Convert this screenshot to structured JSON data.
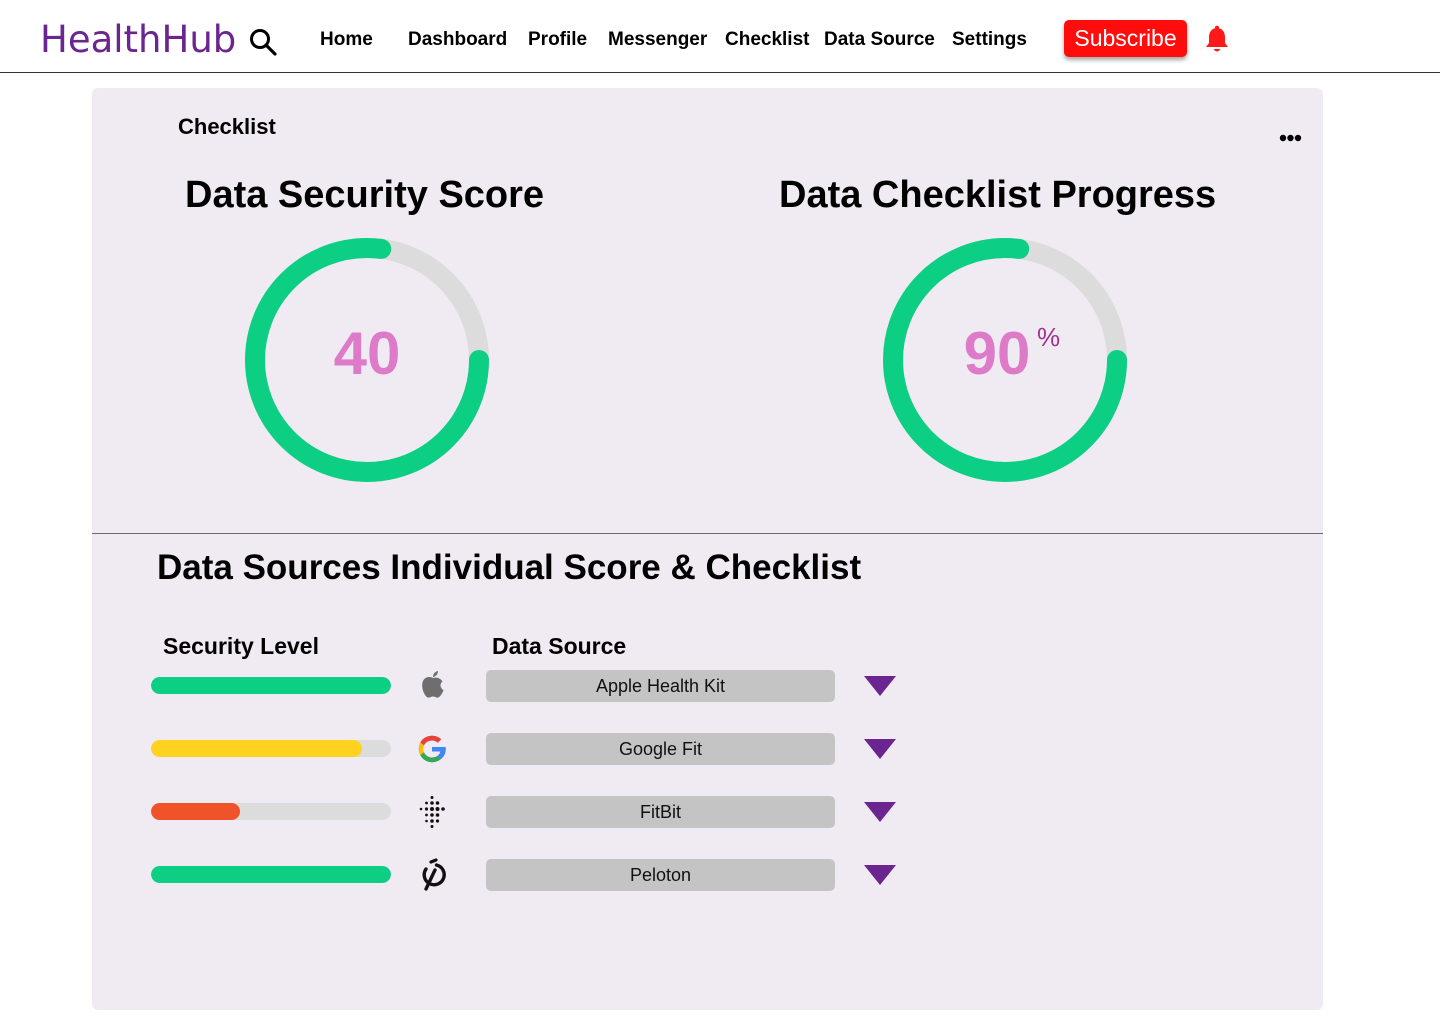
{
  "header": {
    "logo": "HealthHub",
    "nav": [
      "Home",
      "Dashboard",
      "Profile",
      "Messenger",
      "Checklist",
      "Data Source",
      "Settings"
    ],
    "subscribe_label": "Subscribe"
  },
  "card": {
    "title": "Checklist",
    "security_gauge": {
      "title": "Data Security Score",
      "value": "40",
      "fraction": 0.77
    },
    "progress_gauge": {
      "title": "Data Checklist Progress",
      "value": "90",
      "unit": "%",
      "fraction": 0.77
    },
    "section_title": "Data Sources Individual Score & Checklist",
    "col_security": "Security Level",
    "col_source": "Data Source",
    "sources": [
      {
        "name": "Apple Health Kit",
        "icon": "apple-icon",
        "level": 1.0,
        "color": "#0ccf84"
      },
      {
        "name": "Google Fit",
        "icon": "google-icon",
        "level": 0.88,
        "color": "#ffd21f"
      },
      {
        "name": "FitBit",
        "icon": "fitbit-icon",
        "level": 0.37,
        "color": "#f0522a"
      },
      {
        "name": "Peloton",
        "icon": "peloton-icon",
        "level": 1.0,
        "color": "#0ccf84"
      }
    ]
  },
  "colors": {
    "brand": "#6b2590",
    "accent_green": "#0ccf84",
    "gauge_track": "#dcdcdc",
    "gauge_value": "#dd7bc9",
    "subscribe": "#ff0c0c",
    "toggle": "#6b2590",
    "card_bg": "#f0ebf3"
  }
}
